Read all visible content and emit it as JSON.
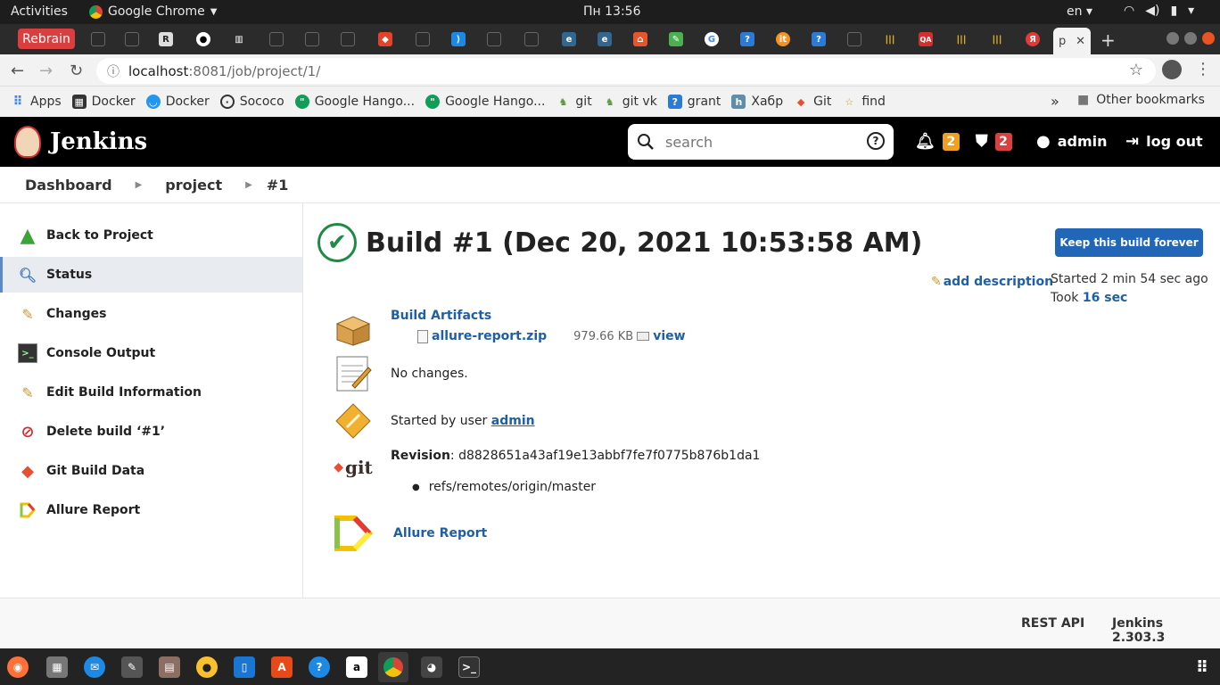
{
  "os": {
    "activities": "Activities",
    "app_name": "Google Chrome",
    "clock": "Пн 13:56",
    "lang": "en"
  },
  "browser": {
    "first_tab_label": "Rebrain",
    "active_tab_label": "p",
    "url_host": "localhost",
    "url_path": ":8081/job/project/1/",
    "bookmarks": [
      {
        "label": "Apps",
        "icon": "apps-grid-icon"
      },
      {
        "label": "Docker",
        "icon": "docker-icon"
      },
      {
        "label": "Docker",
        "icon": "docker-whale-icon"
      },
      {
        "label": "Sococo",
        "icon": "sococo-icon"
      },
      {
        "label": "Google Hango...",
        "icon": "hangouts-icon"
      },
      {
        "label": "Google Hango...",
        "icon": "hangouts-icon"
      },
      {
        "label": "git",
        "icon": "gitlab-icon"
      },
      {
        "label": "git vk",
        "icon": "gitlab-icon"
      },
      {
        "label": "grant",
        "icon": "grant-icon"
      },
      {
        "label": "Хабр",
        "icon": "habr-icon"
      },
      {
        "label": "Git",
        "icon": "git-icon"
      },
      {
        "label": "find",
        "icon": "star-icon"
      }
    ],
    "bookmarks_more": "»",
    "other_bookmarks": "Other bookmarks"
  },
  "jenkins": {
    "brand": "Jenkins",
    "search_placeholder": "search",
    "notifications_count": "2",
    "security_count": "2",
    "user": "admin",
    "logout": "log out",
    "breadcrumb": [
      "Dashboard",
      "project",
      "#1"
    ],
    "tasks": [
      {
        "label": "Back to Project"
      },
      {
        "label": "Status"
      },
      {
        "label": "Changes"
      },
      {
        "label": "Console Output"
      },
      {
        "label": "Edit Build Information"
      },
      {
        "label": "Delete build ‘#1’"
      },
      {
        "label": "Git Build Data"
      },
      {
        "label": "Allure Report"
      }
    ],
    "build": {
      "title": "Build #1 (Dec 20, 2021 10:53:58 AM)",
      "keep_forever": "Keep this build forever",
      "add_description": "add description",
      "started_ago": "Started 2 min 54 sec ago",
      "took_prefix": "Took",
      "took_value": "16 sec",
      "artifacts_heading": "Build Artifacts",
      "artifact_name": "allure-report.zip",
      "artifact_size": "979.66 KB",
      "artifact_view": "view",
      "no_changes": "No changes.",
      "started_by_prefix": "Started by user",
      "started_by_user": "admin",
      "revision_label": "Revision",
      "revision_value": ": d8828651a43af19e13abbf7fe7f0775b876b1da1",
      "ref": "refs/remotes/origin/master",
      "git_logo_text": "git",
      "allure_link": "Allure Report"
    },
    "footer": {
      "rest_api": "REST API",
      "version": "Jenkins 2.303.3"
    }
  }
}
